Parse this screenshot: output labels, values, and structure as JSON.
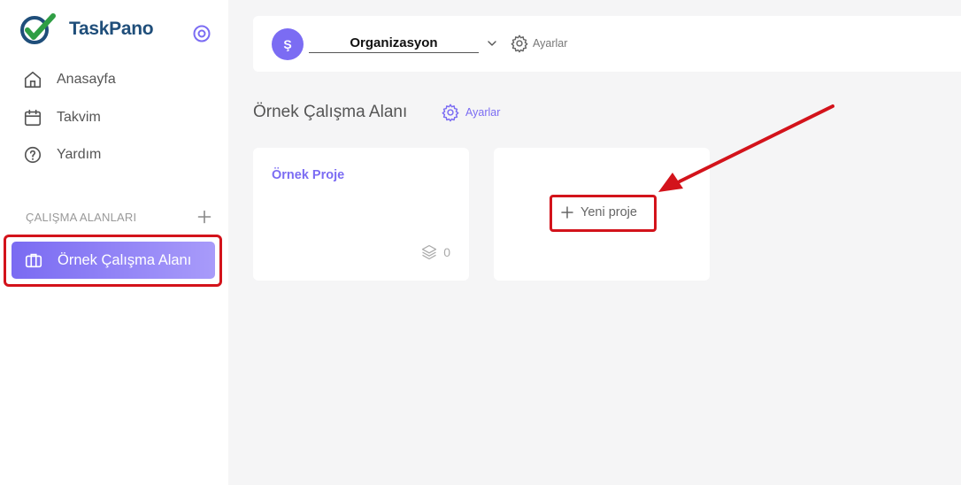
{
  "brand": {
    "name": "TaskPano"
  },
  "sidebar": {
    "nav": [
      {
        "label": "Anasayfa",
        "icon": "home-icon"
      },
      {
        "label": "Takvim",
        "icon": "calendar-icon"
      },
      {
        "label": "Yardım",
        "icon": "help-icon"
      }
    ],
    "workspaces_header": "ÇALIŞMA ALANLARI",
    "workspaces": [
      {
        "label": "Örnek Çalışma Alanı",
        "icon": "briefcase-icon",
        "active": true
      }
    ]
  },
  "topbar": {
    "org_avatar": "Ş",
    "org_name": "Organizasyon",
    "settings_label": "Ayarlar"
  },
  "main": {
    "title": "Örnek Çalışma Alanı",
    "settings_label": "Ayarlar",
    "projects": [
      {
        "name": "Örnek Proje",
        "count": "0"
      }
    ],
    "new_project_label": "Yeni proje"
  },
  "colors": {
    "accent": "#7b6cf3",
    "brand": "#1f4e7a",
    "highlight": "#d3131b"
  }
}
